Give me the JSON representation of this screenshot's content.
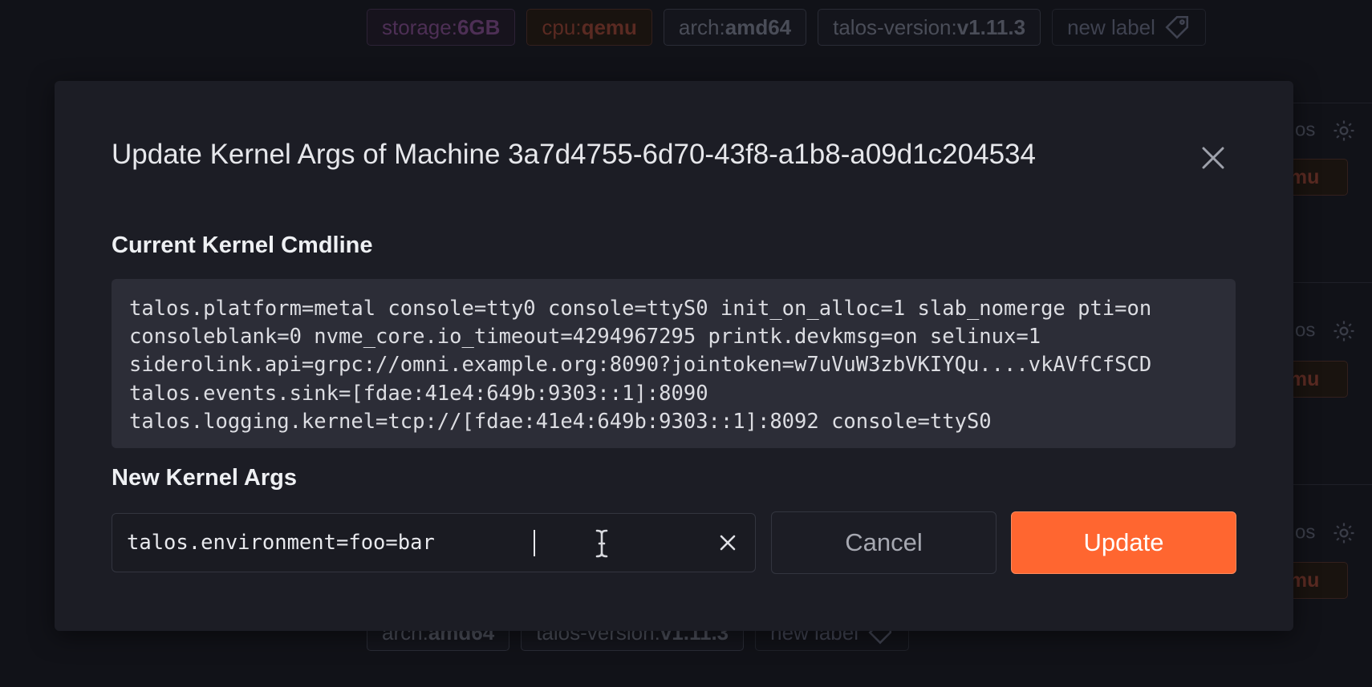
{
  "background": {
    "top_labels": [
      {
        "key": "storage:",
        "value": "6GB"
      },
      {
        "key": "cpu:",
        "value": "qemu"
      },
      {
        "key": "arch:",
        "value": "amd64"
      },
      {
        "key": "talos-version:",
        "value": "v1.11.3"
      }
    ],
    "new_label_text": "new label",
    "bottom_labels": [
      {
        "key": "arch:",
        "value": "amd64"
      },
      {
        "key": "talos-version:",
        "value": "v1.11.3"
      }
    ],
    "right_side_text": "os",
    "right_side_chip": "emu"
  },
  "modal": {
    "title": "Update Kernel Args of Machine 3a7d4755-6d70-43f8-a1b8-a09d1c204534",
    "current_section_label": "Current Kernel Cmdline",
    "cmdline_lines": [
      "talos.platform=metal console=tty0 console=ttyS0 init_on_alloc=1 slab_nomerge pti=on",
      "consoleblank=0 nvme_core.io_timeout=4294967295 printk.devkmsg=on selinux=1",
      "siderolink.api=grpc://omni.example.org:8090?jointoken=w7uVuW3zbVKIYQu....vkAVfCfSCD",
      "talos.events.sink=[fdae:41e4:649b:9303::1]:8090",
      "talos.logging.kernel=tcp://[fdae:41e4:649b:9303::1]:8092 console=ttyS0"
    ],
    "new_section_label": "New Kernel Args",
    "new_args_value": "talos.environment=foo=bar",
    "cancel_label": "Cancel",
    "update_label": "Update"
  },
  "colors": {
    "accent": "#ff6630",
    "modal_bg": "#1c1d25",
    "code_bg": "#2c2d37"
  },
  "icons": {
    "close": "close-icon",
    "clear": "clear-icon",
    "tag": "tag-icon",
    "gear": "gear-icon"
  }
}
